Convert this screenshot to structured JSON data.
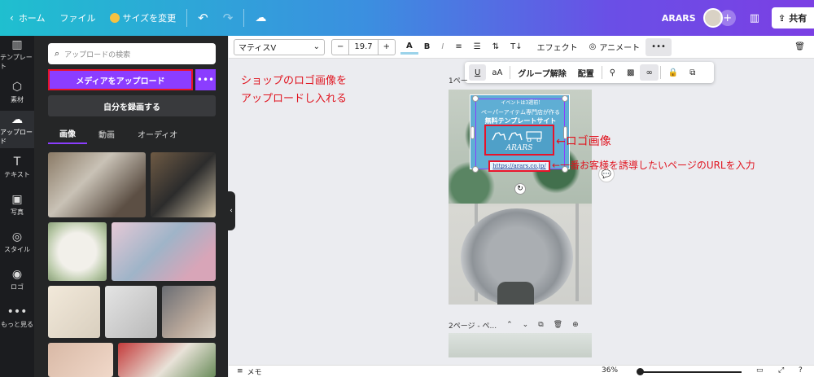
{
  "topbar": {
    "home": "ホーム",
    "file": "ファイル",
    "resize": "サイズを変更",
    "project_name": "ARARS",
    "share": "共有"
  },
  "rail": [
    {
      "label": "テンプレート",
      "icon": "▥"
    },
    {
      "label": "素材",
      "icon": "⬡"
    },
    {
      "label": "アップロード",
      "icon": "☁"
    },
    {
      "label": "テキスト",
      "icon": "T"
    },
    {
      "label": "写真",
      "icon": "▣"
    },
    {
      "label": "スタイル",
      "icon": "◎"
    },
    {
      "label": "ロゴ",
      "icon": "◉"
    },
    {
      "label": "もっと見る",
      "icon": "•••"
    }
  ],
  "panel": {
    "search_placeholder": "アップロードの検索",
    "upload_button": "メディアをアップロード",
    "record_button": "自分を録画する",
    "tabs": [
      "画像",
      "動画",
      "オーディオ"
    ]
  },
  "toolbar": {
    "font": "マティスV",
    "font_size": "19.7",
    "minus": "−",
    "plus": "+",
    "effects": "エフェクト",
    "animate": "アニメート"
  },
  "floatbar": {
    "case": "aA",
    "ungroup": "グループ解除",
    "position": "配置"
  },
  "canvas": {
    "page1_label": "1ペー",
    "card_line1": "イベントは3週前!",
    "card_line2": "ペーパーアイテム専門店が作る",
    "card_line3": "無料テンプレートサイト",
    "logo_text": "ARARS",
    "url": "https://arars.co.jp/",
    "page2_label": "2ページ - ペ..."
  },
  "annotations": {
    "upload_note_1": "ショップのロゴ画像を",
    "upload_note_2": "アップロードし入れる",
    "logo_note": "←ロゴ画像",
    "url_note": "←一番お客様を誘導したいページのURLを入力"
  },
  "bottom": {
    "notes": "メモ",
    "zoom": "36%"
  },
  "colors": {
    "accent": "#8b3dff",
    "annotation": "#e0141f"
  }
}
